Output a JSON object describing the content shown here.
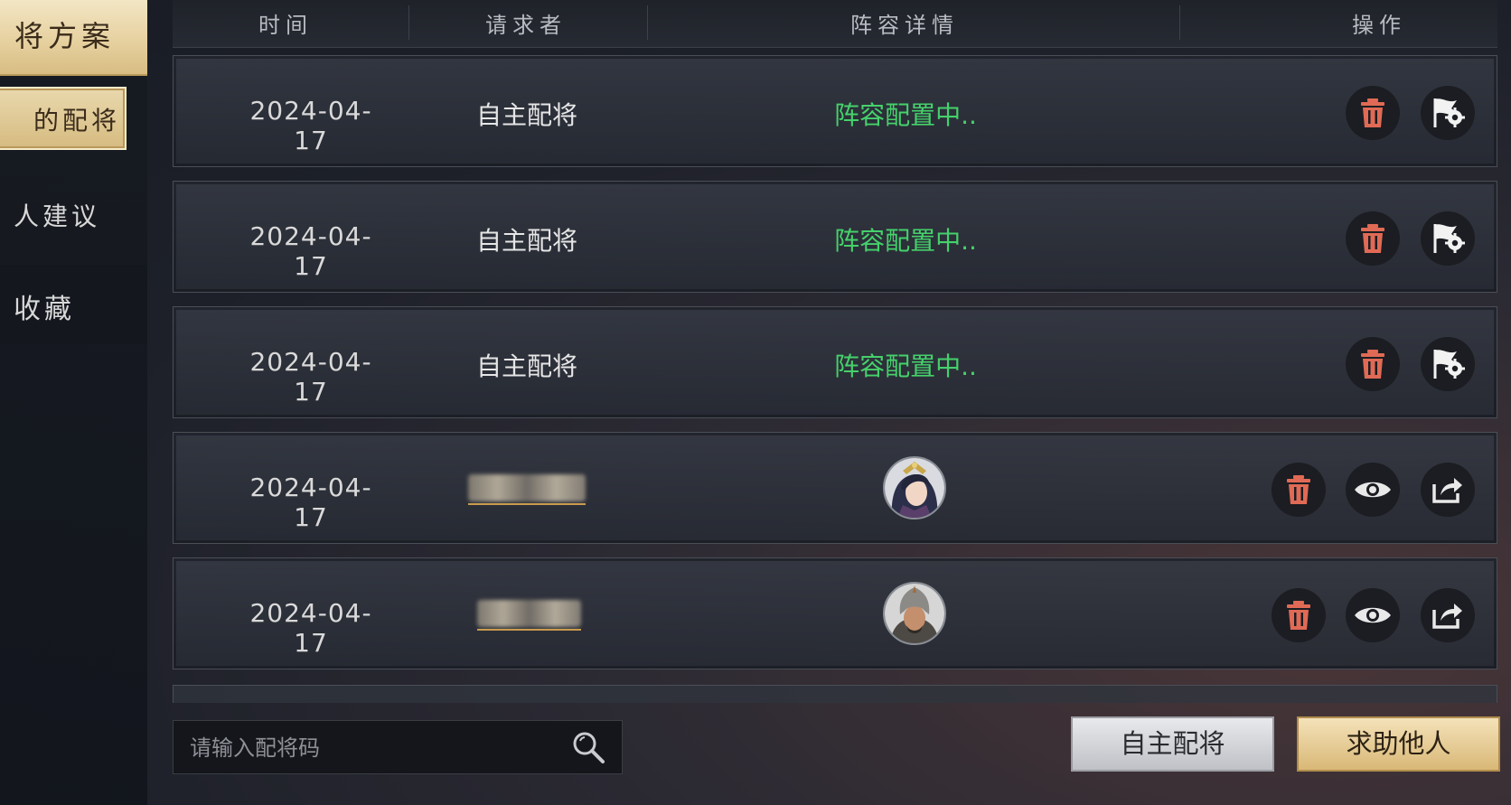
{
  "sidebar": {
    "title": "将方案",
    "items": [
      {
        "label": "的配将"
      },
      {
        "label": "人建议"
      },
      {
        "label": "收藏"
      }
    ]
  },
  "table": {
    "columns": [
      "时间",
      "请求者",
      "阵容详情",
      "操作"
    ],
    "rows": [
      {
        "date": "2024-04-17",
        "requester": "自主配将",
        "detail": "阵容配置中..",
        "actions": [
          "delete-icon",
          "flag-gear-icon"
        ]
      },
      {
        "date": "2024-04-17",
        "requester": "自主配将",
        "detail": "阵容配置中..",
        "actions": [
          "delete-icon",
          "flag-gear-icon"
        ]
      },
      {
        "date": "2024-04-17",
        "requester": "自主配将",
        "detail": "阵容配置中..",
        "actions": [
          "delete-icon",
          "flag-gear-icon"
        ]
      },
      {
        "date": "2024-04-17",
        "requester": "",
        "detail": "",
        "avatar": "female-general-avatar",
        "actions": [
          "delete-icon",
          "eye-icon",
          "share-icon"
        ]
      },
      {
        "date": "2024-04-17",
        "requester": "",
        "detail": "",
        "avatar": "helmeted-general-avatar",
        "actions": [
          "delete-icon",
          "eye-icon",
          "share-icon"
        ]
      }
    ]
  },
  "search": {
    "placeholder": "请输入配将码",
    "value": ""
  },
  "buttons": {
    "self_config": "自主配将",
    "ask_help": "求助他人"
  },
  "colors": {
    "status_green": "#45d16b",
    "delete_red": "#e06a55",
    "gold": "#e5cf9d"
  }
}
